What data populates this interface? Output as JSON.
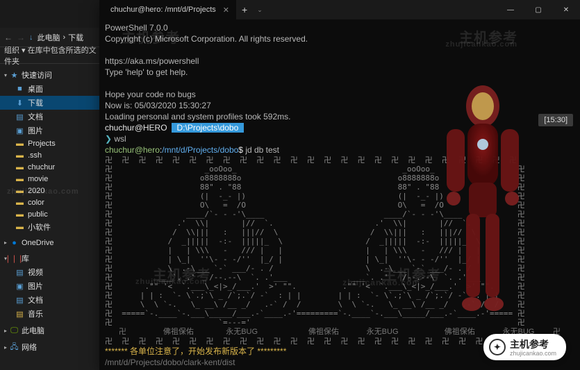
{
  "explorer": {
    "breadcrumb": [
      "此电脑",
      "下载"
    ],
    "toolbar2": "组织 ▾   在库中包含所选的文件夹",
    "groups": [
      {
        "header": "快速访问",
        "icon": "star",
        "items": [
          {
            "label": "桌面",
            "icon": "desktop"
          },
          {
            "label": "下载",
            "icon": "dl",
            "selected": true
          },
          {
            "label": "文档",
            "icon": "doc"
          },
          {
            "label": "图片",
            "icon": "img"
          },
          {
            "label": "Projects",
            "icon": "folder"
          },
          {
            "label": ".ssh",
            "icon": "folder"
          },
          {
            "label": "chuchur",
            "icon": "folder"
          },
          {
            "label": "movie",
            "icon": "folder"
          },
          {
            "label": "2020",
            "icon": "folder"
          },
          {
            "label": "color",
            "icon": "folder"
          },
          {
            "label": "public",
            "icon": "folder"
          },
          {
            "label": "小软件",
            "icon": "folder"
          }
        ]
      },
      {
        "header": "OneDrive",
        "icon": "onedrive",
        "items": []
      },
      {
        "header": "库",
        "icon": "lib",
        "items": [
          {
            "label": "视频",
            "icon": "video"
          },
          {
            "label": "图片",
            "icon": "img"
          },
          {
            "label": "文档",
            "icon": "doc"
          },
          {
            "label": "音乐",
            "icon": "music"
          }
        ]
      },
      {
        "header": "此电脑",
        "icon": "pc",
        "items": []
      },
      {
        "header": "网络",
        "icon": "net",
        "items": []
      }
    ]
  },
  "terminal": {
    "tab_title": "chuchur@hero: /mnt/d/Projects",
    "lines_header": [
      "PowerShell 7.0.0",
      "Copyright (c) Microsoft Corporation. All rights reserved.",
      "",
      "https://aka.ms/powershell",
      "Type 'help' to get help.",
      "",
      "Hope your code no bugs",
      "Now is: 05/03/2020 15:30:27",
      "Loading personal and system profiles took 592ms."
    ],
    "prompt1_user": "chuchur@HERO",
    "prompt1_path": " D:\\Projects\\dobo ",
    "prompt1_cmd": "wsl",
    "prompt2_user": "chuchur@hero",
    "prompt2_path": "/mnt/d/Projects/dobo",
    "prompt2_cmd": "jd db test",
    "time_badge": "[15:30]",
    "banner_line": "******* 各单位注意了，开始发布新版本了 *********",
    "path_line": "/mnt/d/Projects/dobo/clark-kent/dist",
    "footer_labels": [
      "佛祖保佑",
      "永无BUG",
      "佛祖保佑",
      "永无BUG",
      "佛祖保佑",
      "永无BUG"
    ]
  },
  "watermark": {
    "brand": "主机参考",
    "url": "zhujicankao.com"
  }
}
